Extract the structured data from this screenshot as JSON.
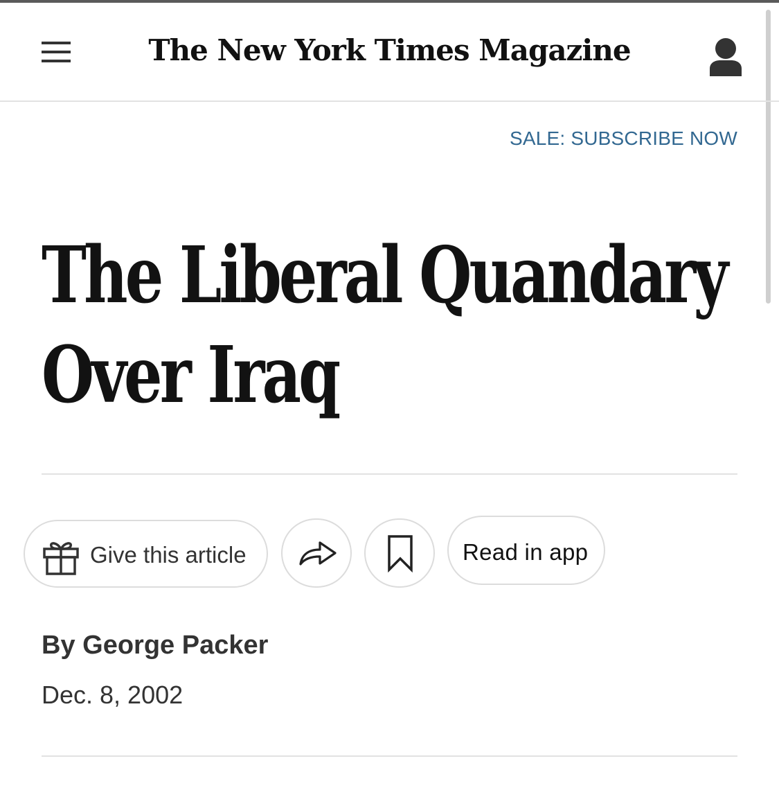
{
  "header": {
    "masthead": "The New York Times Magazine",
    "menu_icon": "hamburger-menu-icon",
    "account_icon": "user-account-icon"
  },
  "promo": {
    "subscribe_label": "SALE: SUBSCRIBE NOW"
  },
  "article": {
    "headline_line1": "The Liberal Quandary",
    "headline_line2": "Over Iraq",
    "byline": "By George Packer",
    "date": "Dec. 8, 2002"
  },
  "actions": {
    "give_label": "Give this article",
    "give_icon": "gift-icon",
    "share_icon": "share-arrow-icon",
    "save_icon": "bookmark-icon",
    "app_label": "Read in app"
  },
  "colors": {
    "link": "#326891",
    "text": "#121212",
    "border": "#dcdcdc"
  }
}
